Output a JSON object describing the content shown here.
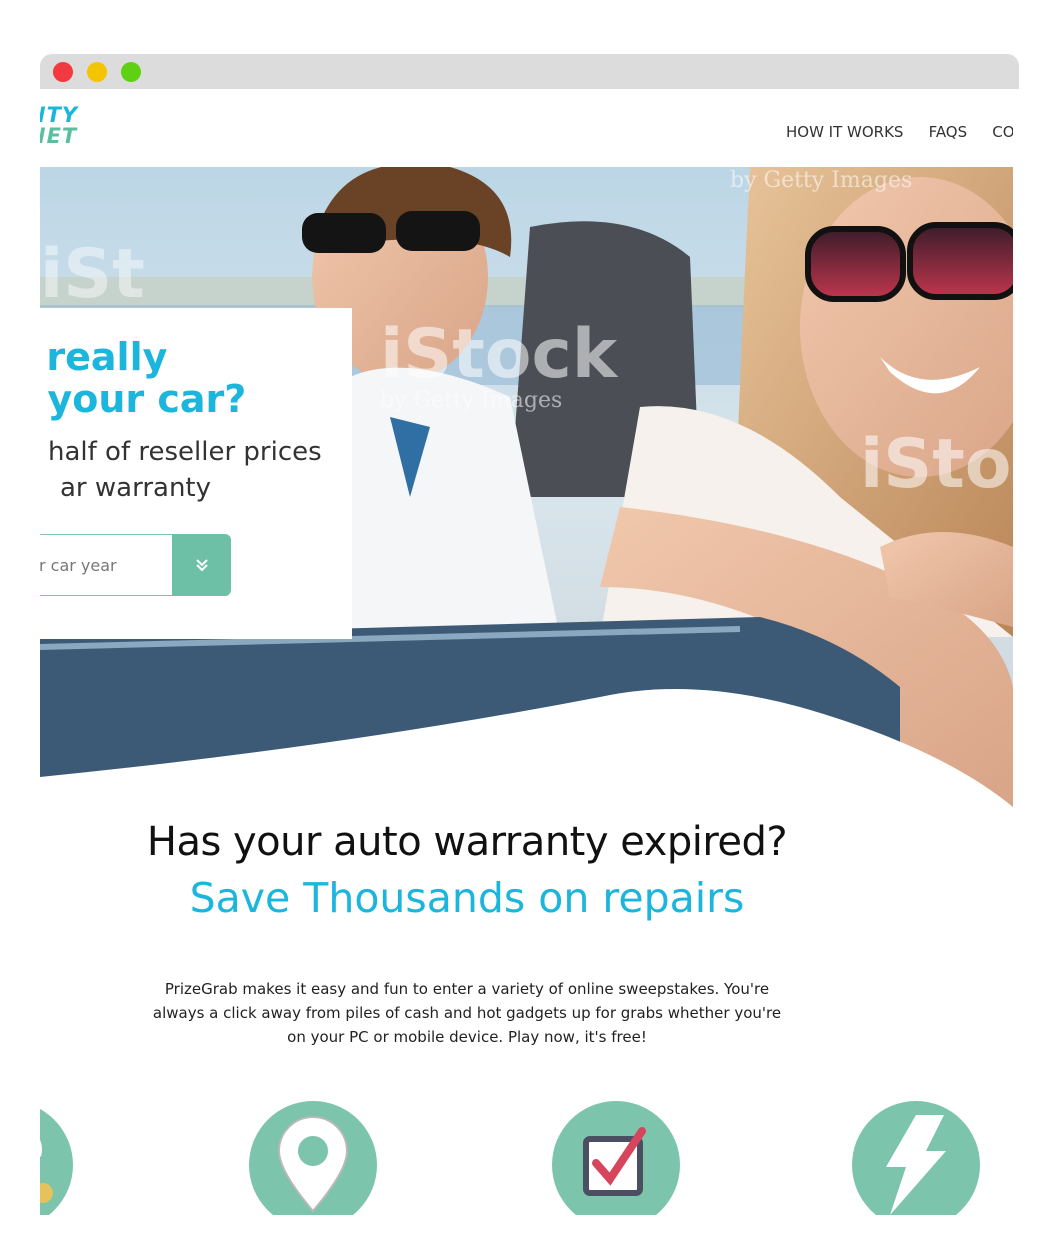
{
  "window": {
    "controls": [
      "close",
      "minimize",
      "maximize"
    ],
    "colors": {
      "close": "#f03a3f",
      "minimize": "#f5c400",
      "maximize": "#5ed112",
      "chrome": "#dcdcdc"
    }
  },
  "header": {
    "logo_line1": "NTY",
    "logo_line2": "NET",
    "logo_colors": {
      "line1": "#1cb6dd",
      "line2": "#5bbf9f"
    },
    "nav": [
      "HOW IT WORKS",
      "FAQS",
      "CON"
    ]
  },
  "hero": {
    "title_line1": "ou really",
    "title_line2": "ng your car?",
    "subtitle_line1": "half of reseller prices",
    "subtitle_line2": "ar warranty",
    "select_placeholder": "r car year",
    "button_icon": "double-chevron-down-icon",
    "accent": "#1cb6dd",
    "button_color": "#6dbfa5"
  },
  "content": {
    "headline": "Has your auto warranty expired?",
    "subheadline": "Save Thousands on repairs",
    "body": "PrizeGrab makes it easy and fun to enter a variety of online sweepstakes. You're always a click away from piles of cash and hot gadgets up for grabs whether you're on your PC or mobile device. Play now, it's free!",
    "accent": "#1cb6dd"
  },
  "features": [
    {
      "icon": "dollar-coin-icon"
    },
    {
      "icon": "location-pin-icon"
    },
    {
      "icon": "checkbox-checked-icon"
    },
    {
      "icon": "lightning-bolt-icon"
    }
  ],
  "feature_color": "#7cc4ab"
}
